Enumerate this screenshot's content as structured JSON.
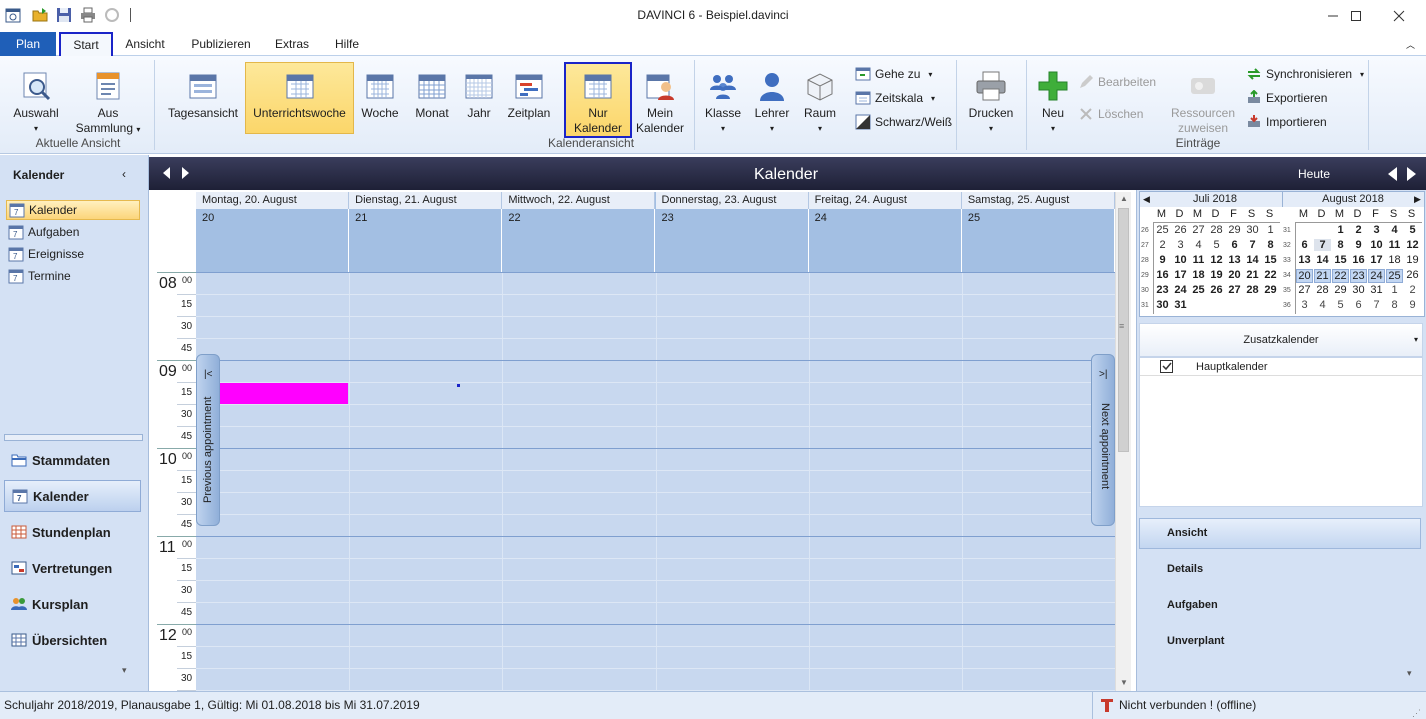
{
  "window": {
    "title": "DAVINCI 6 - Beispiel.davinci"
  },
  "tabs": [
    "Plan",
    "Start",
    "Ansicht",
    "Publizieren",
    "Extras",
    "Hilfe"
  ],
  "ribbon": {
    "auswahl": "Auswahl",
    "aus_sammlung_1": "Aus",
    "aus_sammlung_2": "Sammlung",
    "group_aktuelle_ansicht": "Aktuelle Ansicht",
    "tagesansicht": "Tagesansicht",
    "unterrichtswoche": "Unterrichtswoche",
    "woche": "Woche",
    "monat": "Monat",
    "jahr": "Jahr",
    "zeitplan": "Zeitplan",
    "nur_kalender_1": "Nur",
    "nur_kalender_2": "Kalender",
    "mein_kalender_1": "Mein",
    "mein_kalender_2": "Kalender",
    "klasse": "Klasse",
    "lehrer": "Lehrer",
    "raum": "Raum",
    "gehe_zu": "Gehe zu",
    "zeitskala": "Zeitskala",
    "schwarz_weiss": "Schwarz/Weiß",
    "group_kalenderansicht": "Kalenderansicht",
    "drucken": "Drucken",
    "neu": "Neu",
    "bearbeiten": "Bearbeiten",
    "loeschen": "Löschen",
    "ressourcen_1": "Ressourcen",
    "ressourcen_2": "zuweisen",
    "synchronisieren": "Synchronisieren",
    "exportieren": "Exportieren",
    "importieren": "Importieren",
    "group_eintraege": "Einträge"
  },
  "left": {
    "header": "Kalender",
    "items": [
      "Kalender",
      "Aufgaben",
      "Ereignisse",
      "Termine"
    ],
    "nav": [
      "Stammdaten",
      "Kalender",
      "Stundenplan",
      "Vertretungen",
      "Kursplan",
      "Übersichten"
    ]
  },
  "calendar": {
    "header": "Kalender",
    "today": "Heute",
    "days": [
      {
        "label": "Montag, 20. August",
        "num": "20"
      },
      {
        "label": "Dienstag, 21. August",
        "num": "21"
      },
      {
        "label": "Mittwoch, 22. August",
        "num": "22"
      },
      {
        "label": "Donnerstag, 23. August",
        "num": "23"
      },
      {
        "label": "Freitag, 24. August",
        "num": "24"
      },
      {
        "label": "Samstag, 25. August",
        "num": "25"
      }
    ],
    "hours": [
      "08",
      "09",
      "10",
      "11",
      "12"
    ],
    "hour_min": "00",
    "quarters": [
      "15",
      "30",
      "45"
    ],
    "prev_appointment": "Previous appointment",
    "next_appointment": "Next appointment",
    "appointment_color": "#ff00ff"
  },
  "right": {
    "month1": "Juli 2018",
    "month2": "August 2018",
    "weekdays": [
      "M",
      "D",
      "M",
      "D",
      "F",
      "S",
      "S"
    ],
    "july_weeks": [
      "26",
      "27",
      "28",
      "29",
      "30",
      "31"
    ],
    "july": [
      [
        "25",
        "26",
        "27",
        "28",
        "29",
        "30",
        "1"
      ],
      [
        "2",
        "3",
        "4",
        "5",
        "6",
        "7",
        "8"
      ],
      [
        "9",
        "10",
        "11",
        "12",
        "13",
        "14",
        "15"
      ],
      [
        "16",
        "17",
        "18",
        "19",
        "20",
        "21",
        "22"
      ],
      [
        "23",
        "24",
        "25",
        "26",
        "27",
        "28",
        "29"
      ],
      [
        "30",
        "31",
        "",
        "",
        "",
        "",
        ""
      ]
    ],
    "aug_weeks": [
      "31",
      "32",
      "33",
      "34",
      "35",
      "36"
    ],
    "august": [
      [
        "",
        "",
        "1",
        "2",
        "3",
        "4",
        "5"
      ],
      [
        "6",
        "7",
        "8",
        "9",
        "10",
        "11",
        "12"
      ],
      [
        "13",
        "14",
        "15",
        "16",
        "17",
        "18",
        "19"
      ],
      [
        "20",
        "21",
        "22",
        "23",
        "24",
        "25",
        "26"
      ],
      [
        "27",
        "28",
        "29",
        "30",
        "31",
        "1",
        "2"
      ],
      [
        "3",
        "4",
        "5",
        "6",
        "7",
        "8",
        "9"
      ]
    ],
    "zusatz": "Zusatzkalender",
    "hauptkalender": "Hauptkalender",
    "nav": [
      "Ansicht",
      "Details",
      "Aufgaben",
      "Unverplant"
    ]
  },
  "status": {
    "left": "Schuljahr 2018/2019, Planausgabe 1, Gültig: Mi 01.08.2018 bis Mi 31.07.2019",
    "right": "Nicht verbunden ! (offline)"
  }
}
